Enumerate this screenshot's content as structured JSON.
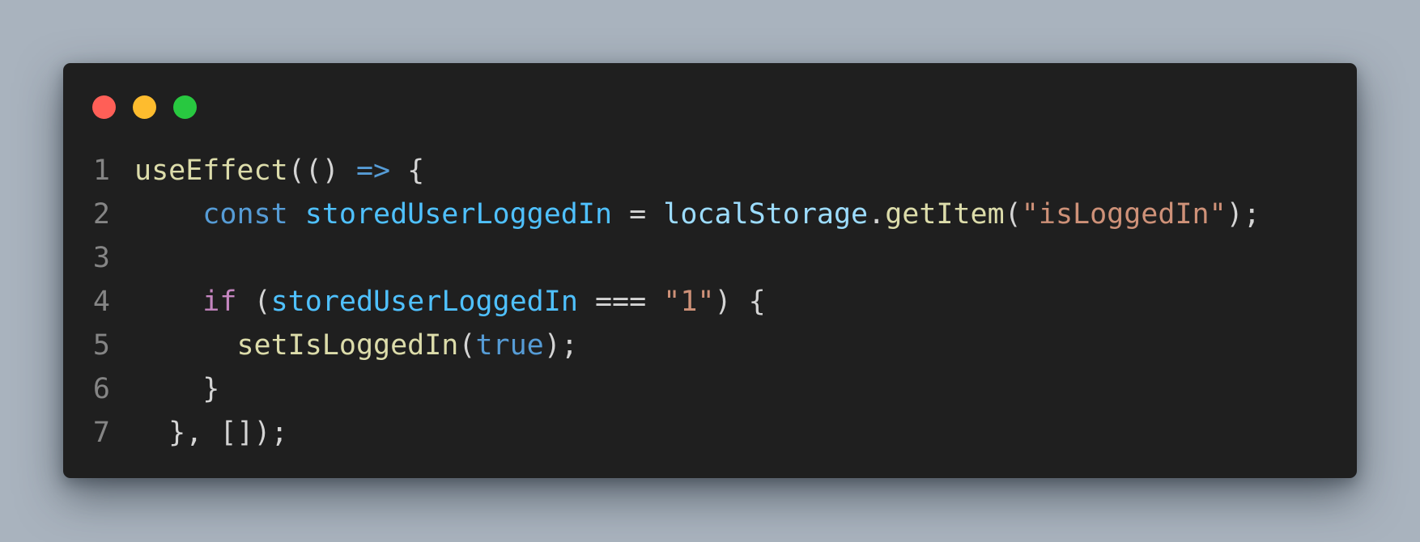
{
  "window": {
    "buttons": [
      {
        "name": "close",
        "color": "#ff5f57"
      },
      {
        "name": "minimize",
        "color": "#febc2e"
      },
      {
        "name": "maximize",
        "color": "#28c840"
      }
    ]
  },
  "code": {
    "language": "javascript",
    "lines": [
      {
        "number": "1",
        "tokens": [
          {
            "text": "useEffect",
            "type": "fn"
          },
          {
            "text": "(() ",
            "type": "op"
          },
          {
            "text": "=>",
            "type": "arrow"
          },
          {
            "text": " {",
            "type": "op"
          }
        ]
      },
      {
        "number": "2",
        "tokens": [
          {
            "text": "    ",
            "type": "op"
          },
          {
            "text": "const",
            "type": "kw"
          },
          {
            "text": " ",
            "type": "op"
          },
          {
            "text": "storedUserLoggedIn",
            "type": "var"
          },
          {
            "text": " = ",
            "type": "op"
          },
          {
            "text": "localStorage",
            "type": "obj"
          },
          {
            "text": ".",
            "type": "op"
          },
          {
            "text": "getItem",
            "type": "fn"
          },
          {
            "text": "(",
            "type": "op"
          },
          {
            "text": "\"isLoggedIn\"",
            "type": "str"
          },
          {
            "text": ");",
            "type": "op"
          }
        ]
      },
      {
        "number": "3",
        "tokens": []
      },
      {
        "number": "4",
        "tokens": [
          {
            "text": "    ",
            "type": "op"
          },
          {
            "text": "if",
            "type": "ctrl"
          },
          {
            "text": " (",
            "type": "op"
          },
          {
            "text": "storedUserLoggedIn",
            "type": "var"
          },
          {
            "text": " === ",
            "type": "op"
          },
          {
            "text": "\"1\"",
            "type": "str"
          },
          {
            "text": ") {",
            "type": "op"
          }
        ]
      },
      {
        "number": "5",
        "tokens": [
          {
            "text": "      ",
            "type": "op"
          },
          {
            "text": "setIsLoggedIn",
            "type": "fn"
          },
          {
            "text": "(",
            "type": "op"
          },
          {
            "text": "true",
            "type": "kw"
          },
          {
            "text": ");",
            "type": "op"
          }
        ]
      },
      {
        "number": "6",
        "tokens": [
          {
            "text": "    }",
            "type": "op"
          }
        ]
      },
      {
        "number": "7",
        "tokens": [
          {
            "text": "  }, []);",
            "type": "op"
          }
        ]
      }
    ]
  }
}
